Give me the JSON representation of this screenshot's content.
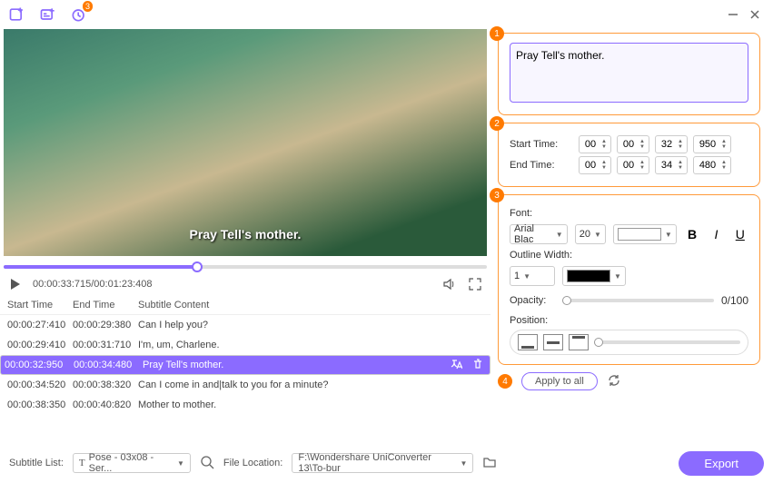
{
  "topbar": {
    "badge": "3"
  },
  "preview": {
    "caption": "Pray Tell's mother.",
    "timecode": "00:00:33:715/00:01:23:408"
  },
  "table": {
    "headers": {
      "start": "Start Time",
      "end": "End Time",
      "content": "Subtitle Content"
    },
    "rows": [
      {
        "start": "00:00:27:410",
        "end": "00:00:29:380",
        "content": "Can I help you?"
      },
      {
        "start": "00:00:29:410",
        "end": "00:00:31:710",
        "content": "I'm, um, Charlene."
      },
      {
        "start": "00:00:32:950",
        "end": "00:00:34:480",
        "content": "Pray Tell's mother."
      },
      {
        "start": "00:00:34:520",
        "end": "00:00:38:320",
        "content": "Can I come in and|talk to you for a minute?"
      },
      {
        "start": "00:00:38:350",
        "end": "00:00:40:820",
        "content": "Mother to mother."
      }
    ],
    "selected": 2
  },
  "editor": {
    "text": "Pray Tell's mother.",
    "startLabel": "Start Time:",
    "endLabel": "End Time:",
    "start": {
      "h": "00",
      "m": "00",
      "s": "32",
      "ms": "950"
    },
    "end": {
      "h": "00",
      "m": "00",
      "s": "34",
      "ms": "480"
    },
    "fontLabel": "Font:",
    "fontName": "Arial Blac",
    "fontSize": "20",
    "outlineLabel": "Outline Width:",
    "outlineWidth": "1",
    "opacityLabel": "Opacity:",
    "opacityValue": "0/100",
    "positionLabel": "Position:",
    "applyLabel": "Apply to all"
  },
  "bottom": {
    "subtitleListLabel": "Subtitle List:",
    "subtitleListValue": "Pose - 03x08 - Ser...",
    "fileLocationLabel": "File Location:",
    "fileLocationValue": "F:\\Wondershare UniConverter 13\\To-bur",
    "exportLabel": "Export"
  }
}
